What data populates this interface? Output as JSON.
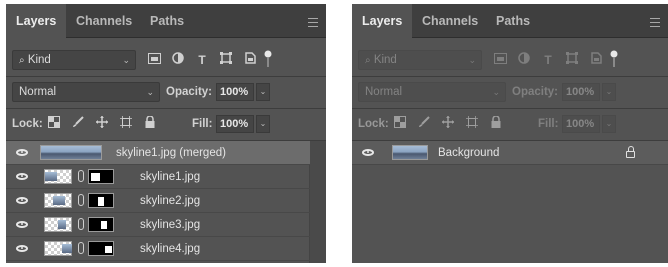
{
  "left_panel": {
    "tabs": [
      "Layers",
      "Channels",
      "Paths"
    ],
    "active_tab": "Layers",
    "filter": {
      "label": "Kind",
      "icons": [
        "image-filter-icon",
        "adjustment-filter-icon",
        "type-filter-icon",
        "shape-filter-icon",
        "smart-object-filter-icon",
        "filter-toggle-icon"
      ]
    },
    "blend_mode": "Normal",
    "opacity": {
      "label": "Opacity:",
      "value": "100%"
    },
    "lock": {
      "label": "Lock:",
      "icons": [
        "lock-transparent-pixels-icon",
        "lock-image-pixels-icon",
        "lock-position-icon",
        "lock-artboard-icon",
        "lock-all-icon"
      ]
    },
    "fill": {
      "label": "Fill:",
      "value": "100%"
    },
    "layers": [
      {
        "name": "skyline1.jpg (merged)",
        "selected": true,
        "has_mask": false
      },
      {
        "name": "skyline1.jpg",
        "selected": false,
        "has_mask": true
      },
      {
        "name": "skyline2.jpg",
        "selected": false,
        "has_mask": true
      },
      {
        "name": "skyline3.jpg",
        "selected": false,
        "has_mask": true
      },
      {
        "name": "skyline4.jpg",
        "selected": false,
        "has_mask": true
      }
    ]
  },
  "right_panel": {
    "tabs": [
      "Layers",
      "Channels",
      "Paths"
    ],
    "active_tab": "Layers",
    "filter": {
      "label": "Kind"
    },
    "blend_mode": "Normal",
    "opacity": {
      "label": "Opacity:",
      "value": "100%"
    },
    "lock": {
      "label": "Lock:"
    },
    "fill": {
      "label": "Fill:",
      "value": "100%"
    },
    "layers": [
      {
        "name": "Background",
        "selected": false,
        "locked": true
      }
    ]
  },
  "colors": {
    "panel_bg": "#535353",
    "tabbar_bg": "#3f3f3f",
    "selected_row": "#6c6c6c",
    "text": "#e4e4e4"
  }
}
